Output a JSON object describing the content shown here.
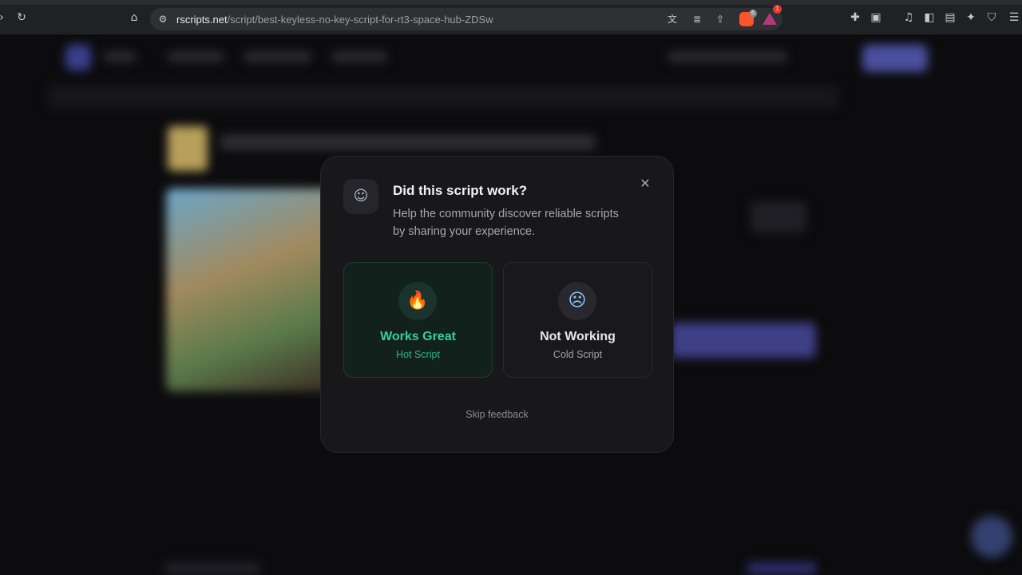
{
  "browser": {
    "url_host": "rscripts.net",
    "url_path": "/script/best-keyless-no-key-script-for-rt3-space-hub-ZDSw",
    "icons": {
      "back": "back-arrow-icon",
      "reload": "reload-icon",
      "bookmark": "bookmark-icon",
      "site_settings": "tune-icon",
      "translate": "translate-icon",
      "reader": "reader-mode-icon",
      "share": "share-icon",
      "shields": "brave-shields-icon",
      "rewards": "brave-rewards-icon",
      "extensions": "extensions-icon",
      "screenshot": "screenshot-icon",
      "media": "media-icon",
      "sidebar": "sidebar-icon",
      "wallet": "wallet-icon",
      "leo": "leo-icon",
      "vpn": "vpn-icon",
      "menu": "menu-icon"
    },
    "shields_badge": "6",
    "rewards_badge": "1"
  },
  "modal": {
    "icon": "ghost-icon",
    "title": "Did this script work?",
    "subtitle": "Help the community discover reliable scripts by sharing your experience.",
    "close_icon": "close-icon",
    "options": [
      {
        "label": "Works Great",
        "sublabel": "Hot Script",
        "icon": "flame-icon",
        "color": "#31d19b"
      },
      {
        "label": "Not Working",
        "sublabel": "Cold Script",
        "icon": "freezing-face-icon",
        "color": "#e6e6ea"
      }
    ],
    "skip_label": "Skip feedback"
  }
}
